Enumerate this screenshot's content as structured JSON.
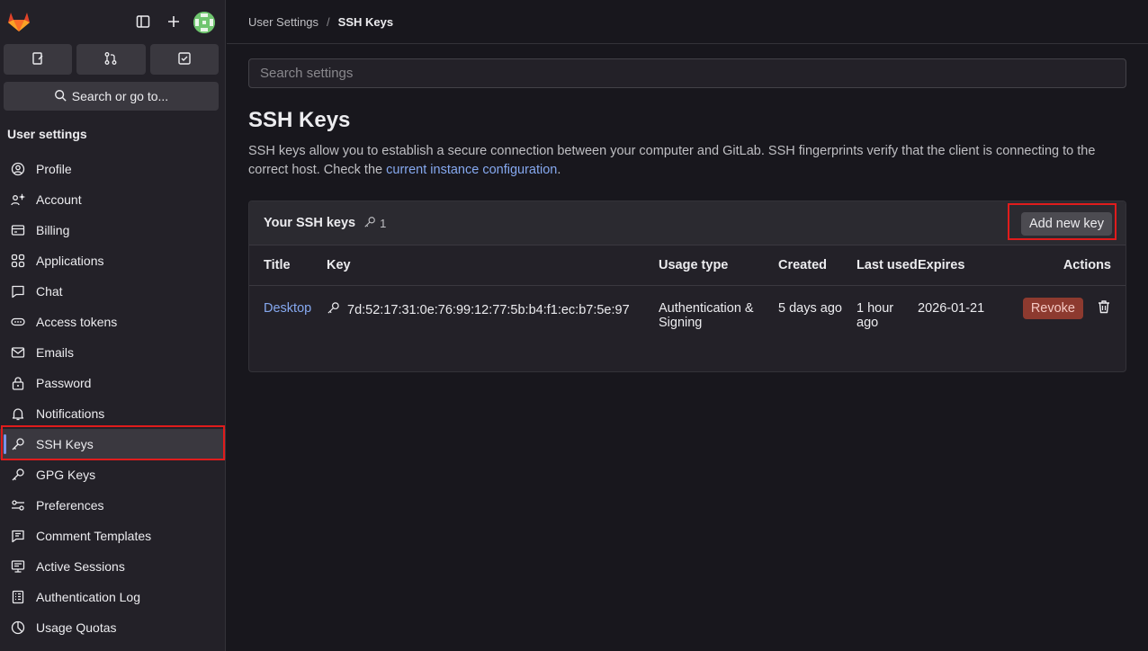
{
  "sidebar": {
    "section_title": "User settings",
    "search_label": "Search or go to...",
    "items": [
      {
        "label": "Profile",
        "icon": "profile-icon"
      },
      {
        "label": "Account",
        "icon": "account-icon"
      },
      {
        "label": "Billing",
        "icon": "billing-icon"
      },
      {
        "label": "Applications",
        "icon": "applications-icon"
      },
      {
        "label": "Chat",
        "icon": "chat-icon"
      },
      {
        "label": "Access tokens",
        "icon": "token-icon"
      },
      {
        "label": "Emails",
        "icon": "email-icon"
      },
      {
        "label": "Password",
        "icon": "lock-icon"
      },
      {
        "label": "Notifications",
        "icon": "bell-icon"
      },
      {
        "label": "SSH Keys",
        "icon": "key-icon",
        "active": true
      },
      {
        "label": "GPG Keys",
        "icon": "key-icon"
      },
      {
        "label": "Preferences",
        "icon": "preferences-icon"
      },
      {
        "label": "Comment Templates",
        "icon": "comment-icon"
      },
      {
        "label": "Active Sessions",
        "icon": "monitor-icon"
      },
      {
        "label": "Authentication Log",
        "icon": "log-icon"
      },
      {
        "label": "Usage Quotas",
        "icon": "quota-icon"
      }
    ]
  },
  "breadcrumb": {
    "parent": "User Settings",
    "separator": "/",
    "current": "SSH Keys"
  },
  "search": {
    "placeholder": "Search settings"
  },
  "page": {
    "title": "SSH Keys",
    "description_pre": "SSH keys allow you to establish a secure connection between your computer and GitLab. SSH fingerprints verify that the client is connecting to the correct host. Check the ",
    "description_link": "current instance configuration",
    "description_post": "."
  },
  "card": {
    "title": "Your SSH keys",
    "count": "1",
    "add_button": "Add new key",
    "columns": [
      "Title",
      "Key",
      "Usage type",
      "Created",
      "Last used",
      "Expires",
      "Actions"
    ],
    "rows": [
      {
        "title": "Desktop",
        "key": "7d:52:17:31:0e:76:99:12:77:5b:b4:f1:ec:b7:5e:97",
        "usage": "Authentication & Signing",
        "created": "5 days ago",
        "last_used": "1 hour ago",
        "expires": "2026-01-21",
        "revoke": "Revoke"
      }
    ]
  },
  "colors": {
    "accent": "#86a9f0",
    "danger": "#8d3a2f",
    "highlight": "#e01c1c"
  }
}
